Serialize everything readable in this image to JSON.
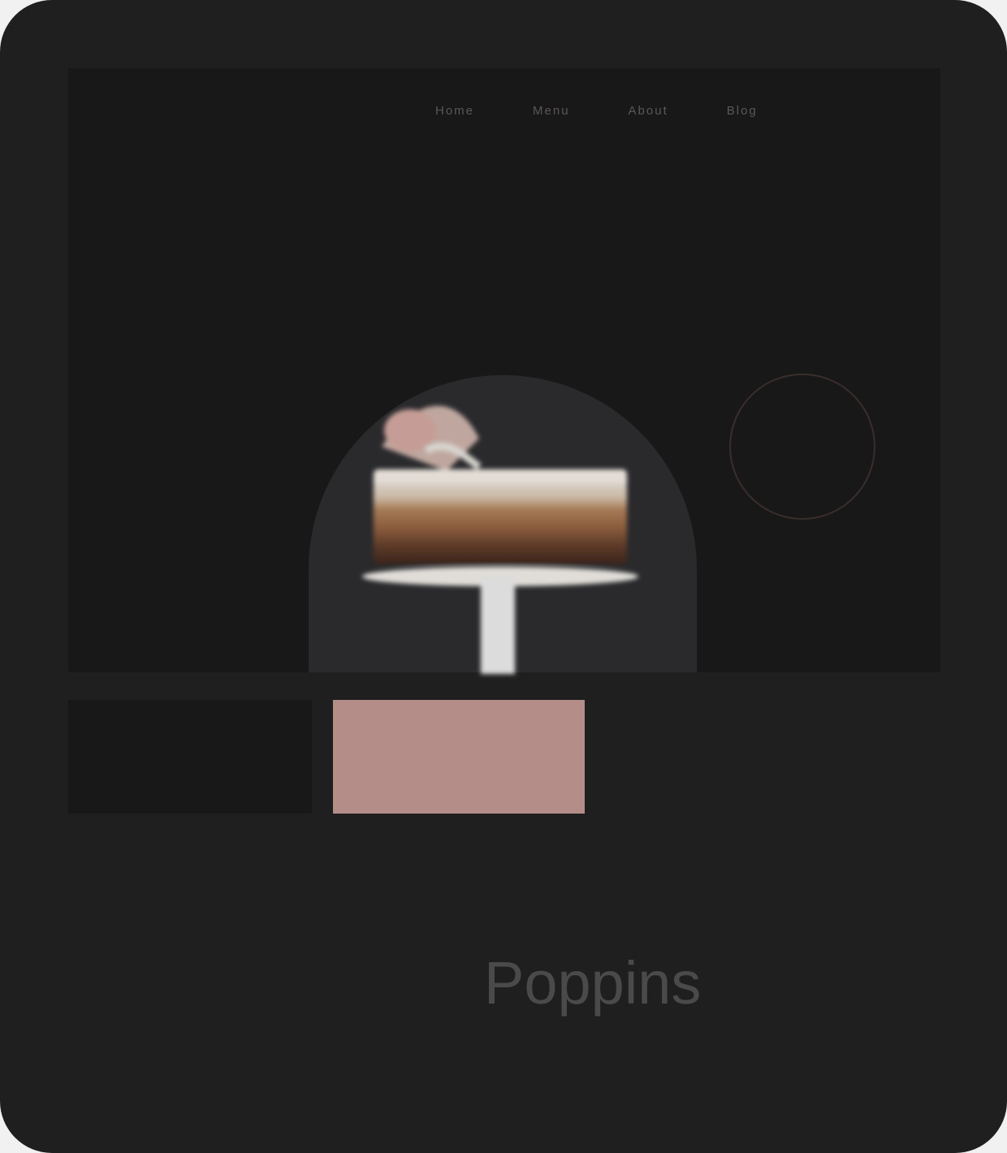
{
  "nav": {
    "items": [
      "Home",
      "Menu",
      "About",
      "Blog"
    ]
  },
  "hero": {
    "headline_lines": [
      "",
      "",
      ""
    ],
    "link_text": "",
    "badge_text": "",
    "image": "cake-on-stand"
  },
  "palette": {
    "swatches": [
      {
        "name": "",
        "color": "#191818",
        "label": ""
      },
      {
        "name": "",
        "color": "#b48d89",
        "label": ""
      }
    ]
  },
  "typography": {
    "fonts": [
      {
        "sample": "",
        "caption": ""
      },
      {
        "sample": "Poppins",
        "caption": ""
      }
    ]
  },
  "colors": {
    "background": "#1f1f1f",
    "hero_bg": "#191818",
    "accent": "#b48d89",
    "headline": "#8a6f6a"
  }
}
